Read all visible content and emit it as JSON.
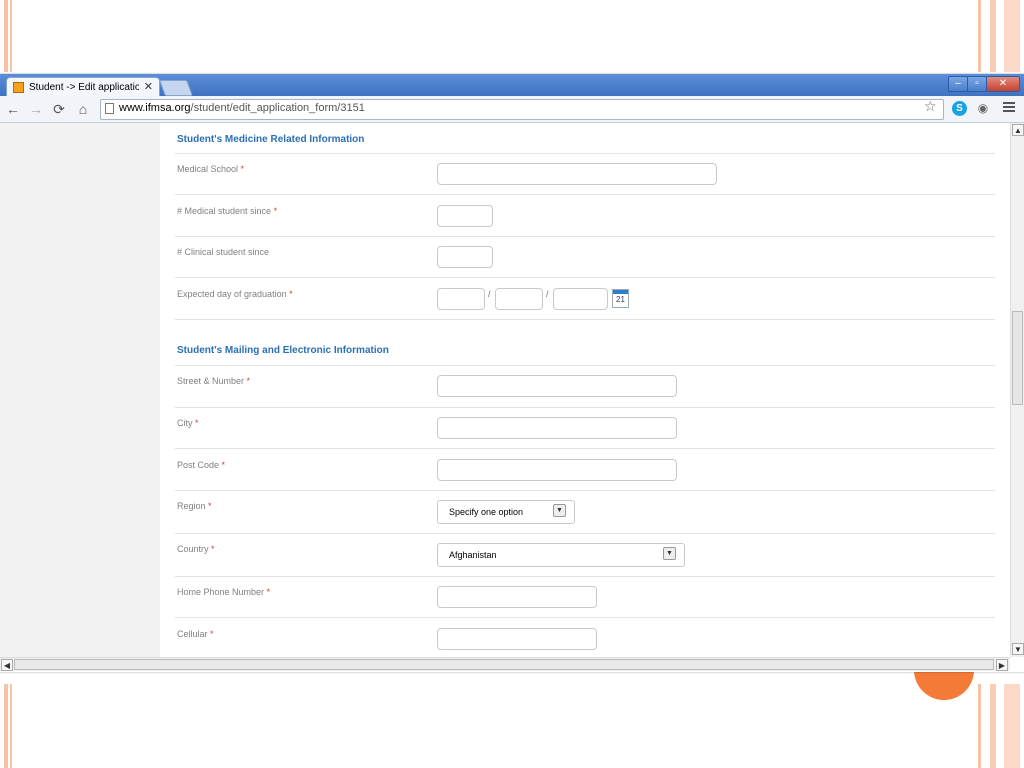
{
  "browser": {
    "tab_title": "Student -> Edit application fo",
    "tab_close": "✕",
    "url_host": "www.ifmsa.org",
    "url_path": "/student/edit_application_form/3151",
    "window_controls": {
      "minimize": "–",
      "maximize": "▫",
      "close": "✕"
    }
  },
  "nav": {
    "back": "←",
    "forward": "→",
    "reload": "⟳",
    "home": "⌂"
  },
  "icons": {
    "star": "☆",
    "skype": "S",
    "eye": "◉"
  },
  "sections": {
    "medicine": {
      "title": "Student's Medicine Related Information",
      "fields": {
        "medical_school": {
          "label": "Medical School",
          "req": "*"
        },
        "medical_since": {
          "label": "# Medical student since",
          "req": "*"
        },
        "clinical_since": {
          "label": "# Clinical student since"
        },
        "graduation": {
          "label": "Expected day of graduation",
          "req": "*",
          "separator": "/",
          "calendar_day": "21"
        }
      }
    },
    "mailing": {
      "title": "Student's Mailing and Electronic Information",
      "fields": {
        "street": {
          "label": "Street & Number",
          "req": "*"
        },
        "city": {
          "label": "City",
          "req": "*"
        },
        "postcode": {
          "label": "Post Code",
          "req": "*"
        },
        "region": {
          "label": "Region",
          "req": "*",
          "selected": "Specify one option"
        },
        "country": {
          "label": "Country",
          "req": "*",
          "selected": "Afghanistan"
        },
        "home_phone": {
          "label": "Home Phone Number",
          "req": "*"
        },
        "cellular": {
          "label": "Cellular",
          "req": "*"
        }
      }
    }
  },
  "colors": {
    "accent": "#2b6fb6",
    "required": "#d83b3b",
    "slide_orange": "#f47a38"
  }
}
